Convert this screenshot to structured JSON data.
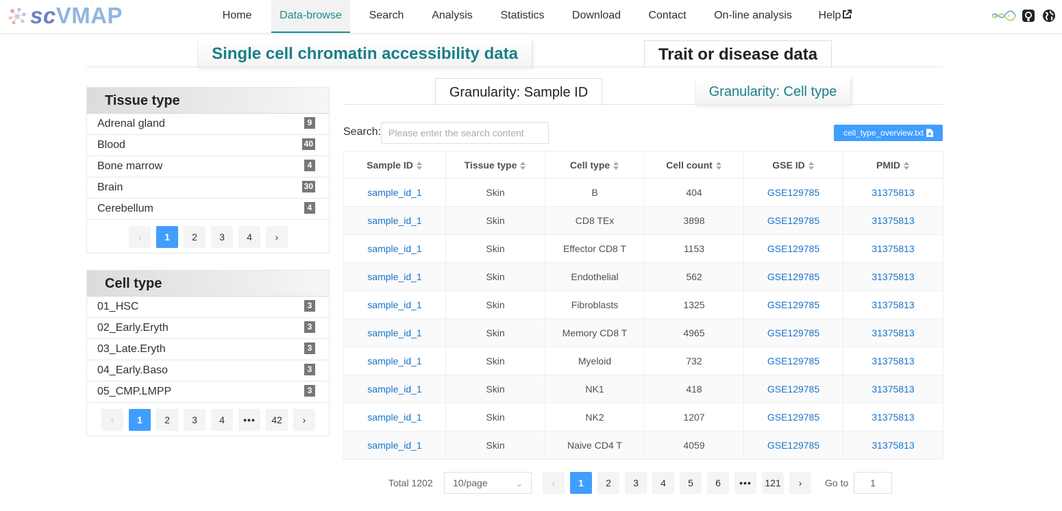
{
  "app": {
    "logo_sc": "sc",
    "logo_vmap": "VMAP"
  },
  "nav": {
    "items": [
      "Home",
      "Data-browse",
      "Search",
      "Analysis",
      "Statistics",
      "Download",
      "Contact",
      "On-line analysis",
      "Help"
    ],
    "active": "Data-browse",
    "icons": [
      "dna-logo-icon",
      "github-icon",
      "globe-icon"
    ]
  },
  "top_tabs": {
    "scatac": "Single cell chromatin accessibility data",
    "trait": "Trait or disease data"
  },
  "tissue_panel": {
    "title": "Tissue type",
    "items": [
      {
        "label": "Adrenal gland",
        "count": "9"
      },
      {
        "label": "Blood",
        "count": "40"
      },
      {
        "label": "Bone marrow",
        "count": "4"
      },
      {
        "label": "Brain",
        "count": "30"
      },
      {
        "label": "Cerebellum",
        "count": "4"
      }
    ],
    "pages": [
      "1",
      "2",
      "3",
      "4"
    ],
    "current_page": "1"
  },
  "celltype_panel": {
    "title": "Cell type",
    "items": [
      {
        "label": "01_HSC",
        "count": "3"
      },
      {
        "label": "02_Early.Eryth",
        "count": "3"
      },
      {
        "label": "03_Late.Eryth",
        "count": "3"
      },
      {
        "label": "04_Early.Baso",
        "count": "3"
      },
      {
        "label": "05_CMP.LMPP",
        "count": "3"
      }
    ],
    "pages": [
      "1",
      "2",
      "3",
      "4",
      "•••",
      "42"
    ],
    "current_page": "1"
  },
  "granularity_tabs": {
    "sample": "Granularity: Sample ID",
    "celltype": "Granularity: Cell type"
  },
  "search": {
    "label": "Search:",
    "placeholder": "Please enter the search content",
    "download_label": "cell_type_overview.txt"
  },
  "table": {
    "columns": [
      "Sample ID",
      "Tissue type",
      "Cell type",
      "Cell count",
      "GSE ID",
      "PMID"
    ],
    "rows": [
      [
        "sample_id_1",
        "Skin",
        "B",
        "404",
        "GSE129785",
        "31375813"
      ],
      [
        "sample_id_1",
        "Skin",
        "CD8 TEx",
        "3898",
        "GSE129785",
        "31375813"
      ],
      [
        "sample_id_1",
        "Skin",
        "Effector CD8 T",
        "1153",
        "GSE129785",
        "31375813"
      ],
      [
        "sample_id_1",
        "Skin",
        "Endothelial",
        "562",
        "GSE129785",
        "31375813"
      ],
      [
        "sample_id_1",
        "Skin",
        "Fibroblasts",
        "1325",
        "GSE129785",
        "31375813"
      ],
      [
        "sample_id_1",
        "Skin",
        "Memory CD8 T",
        "4965",
        "GSE129785",
        "31375813"
      ],
      [
        "sample_id_1",
        "Skin",
        "Myeloid",
        "732",
        "GSE129785",
        "31375813"
      ],
      [
        "sample_id_1",
        "Skin",
        "NK1",
        "418",
        "GSE129785",
        "31375813"
      ],
      [
        "sample_id_1",
        "Skin",
        "NK2",
        "1207",
        "GSE129785",
        "31375813"
      ],
      [
        "sample_id_1",
        "Skin",
        "Naive CD4 T",
        "4059",
        "GSE129785",
        "31375813"
      ]
    ]
  },
  "pagination": {
    "total": "Total 1202",
    "page_size": "10/page",
    "pages": [
      "1",
      "2",
      "3",
      "4",
      "5",
      "6",
      "•••",
      "121"
    ],
    "current_page": "1",
    "goto_label": "Go to",
    "goto_value": "1"
  },
  "colors": {
    "accent": "#1a8c8c",
    "primary": "#409eff",
    "link": "#1a73c9"
  }
}
